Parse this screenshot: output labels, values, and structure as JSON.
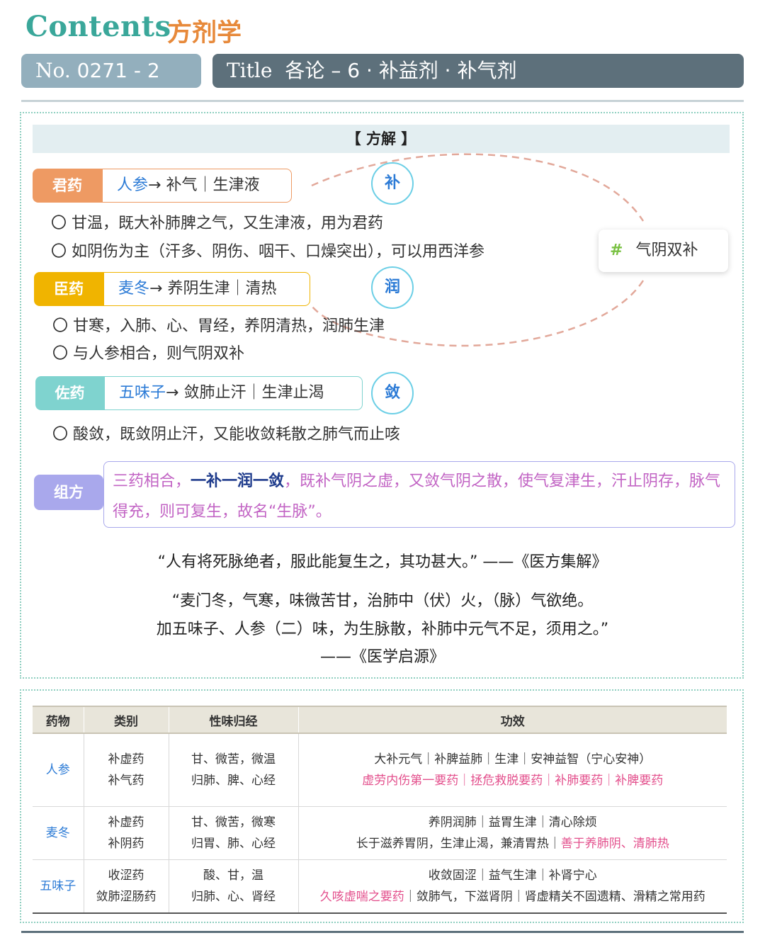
{
  "header": {
    "contents_label": "Contents",
    "subject": "方剂学",
    "no_label": "No.",
    "no_value": "0271 - 2",
    "title_label": "Title",
    "title_value": "各论 – 6 · 补益剂 · 补气剂"
  },
  "section": {
    "banner": "【 方解 】"
  },
  "roles": [
    {
      "tag": "君药",
      "herb": "人参",
      "effect": "→ 补气｜生津液",
      "circle": "补",
      "lines": [
        "〇 甘温，既大补肺脾之气，又生津液，用为君药",
        "〇 如阴伤为主（汗多、阴伤、咽干、口燥突出），可以用西洋参"
      ]
    },
    {
      "tag": "臣药",
      "herb": "麦冬",
      "effect": "→ 养阴生津｜清热",
      "circle": "润",
      "lines": [
        "〇 甘寒，入肺、心、胃经，养阴清热，润肺生津",
        "〇 与人参相合，则气阴双补"
      ]
    },
    {
      "tag": "佐药",
      "herb": "五味子",
      "effect": "→ 敛肺止汗｜生津止渴",
      "circle": "敛",
      "lines": [
        "〇 酸敛，既敛阴止汗，又能收敛耗散之肺气而止咳"
      ]
    }
  ],
  "effect_box": {
    "hash": "#",
    "text": "气阴双补"
  },
  "formula": {
    "tag": "组方",
    "text_1": "三药相合，",
    "text_bold": "一补一润一敛",
    "text_2": "，既补气阴之虚，又敛气阴之散，使气复津生，汗止阴存，脉气得充，则可复生，故名“生脉”。"
  },
  "quotes": {
    "q1": "“人有将死脉绝者，服此能复生之，其功甚大。” ——《医方集解》",
    "q2_line1": "“麦门冬，气寒，味微苦甘，治肺中（伏）火，（脉）气欲绝。",
    "q2_line2": "加五味子、人参（二）味，为生脉散，补肺中元气不足，须用之。”",
    "q2_source": "——《医学启源》"
  },
  "table": {
    "headers": [
      "药物",
      "类别",
      "性味归经",
      "功效"
    ],
    "rows": [
      {
        "herb": "人参",
        "category": [
          "补虚药",
          "补气药"
        ],
        "nature": [
          "甘、微苦，微温",
          "归肺、脾、心经"
        ],
        "effect_line1": "大补元气｜补脾益肺｜生津｜安神益智（宁心安神）",
        "effect_line2_pink": "虚劳内伤第一要药｜拯危救脱要药｜补肺要药｜补脾要药",
        "effect_line2_rest": ""
      },
      {
        "herb": "麦冬",
        "category": [
          "补虚药",
          "补阴药"
        ],
        "nature": [
          "甘、微苦，微寒",
          "归胃、肺、心经"
        ],
        "effect_line1": "养阴润肺｜益胃生津｜清心除烦",
        "effect_line2_rest": "长于滋养胃阴，生津止渴，兼清胃热｜",
        "effect_line2_pink": "善于养肺阴、清肺热"
      },
      {
        "herb": "五味子",
        "category": [
          "收涩药",
          "敛肺涩肠药"
        ],
        "nature": [
          "酸、甘，温",
          "归肺、心、肾经"
        ],
        "effect_line1": "收敛固涩｜益气生津｜补肾宁心",
        "effect_line2_pink": "久咳虚喘之要药",
        "effect_line2_rest": "｜敛肺气，下滋肾阴｜肾虚精关不固遗精、滑精之常用药"
      }
    ]
  },
  "colors": {
    "teal": "#3aa79a",
    "orange": "#e7893a",
    "jun": "#ee9a63",
    "chen": "#f0b400",
    "zuo": "#7fd3cf",
    "zufang": "#a9a8ec",
    "herb_blue": "#2c7bd6",
    "pink": "#e34f8c",
    "purple_text": "#c264c4"
  }
}
